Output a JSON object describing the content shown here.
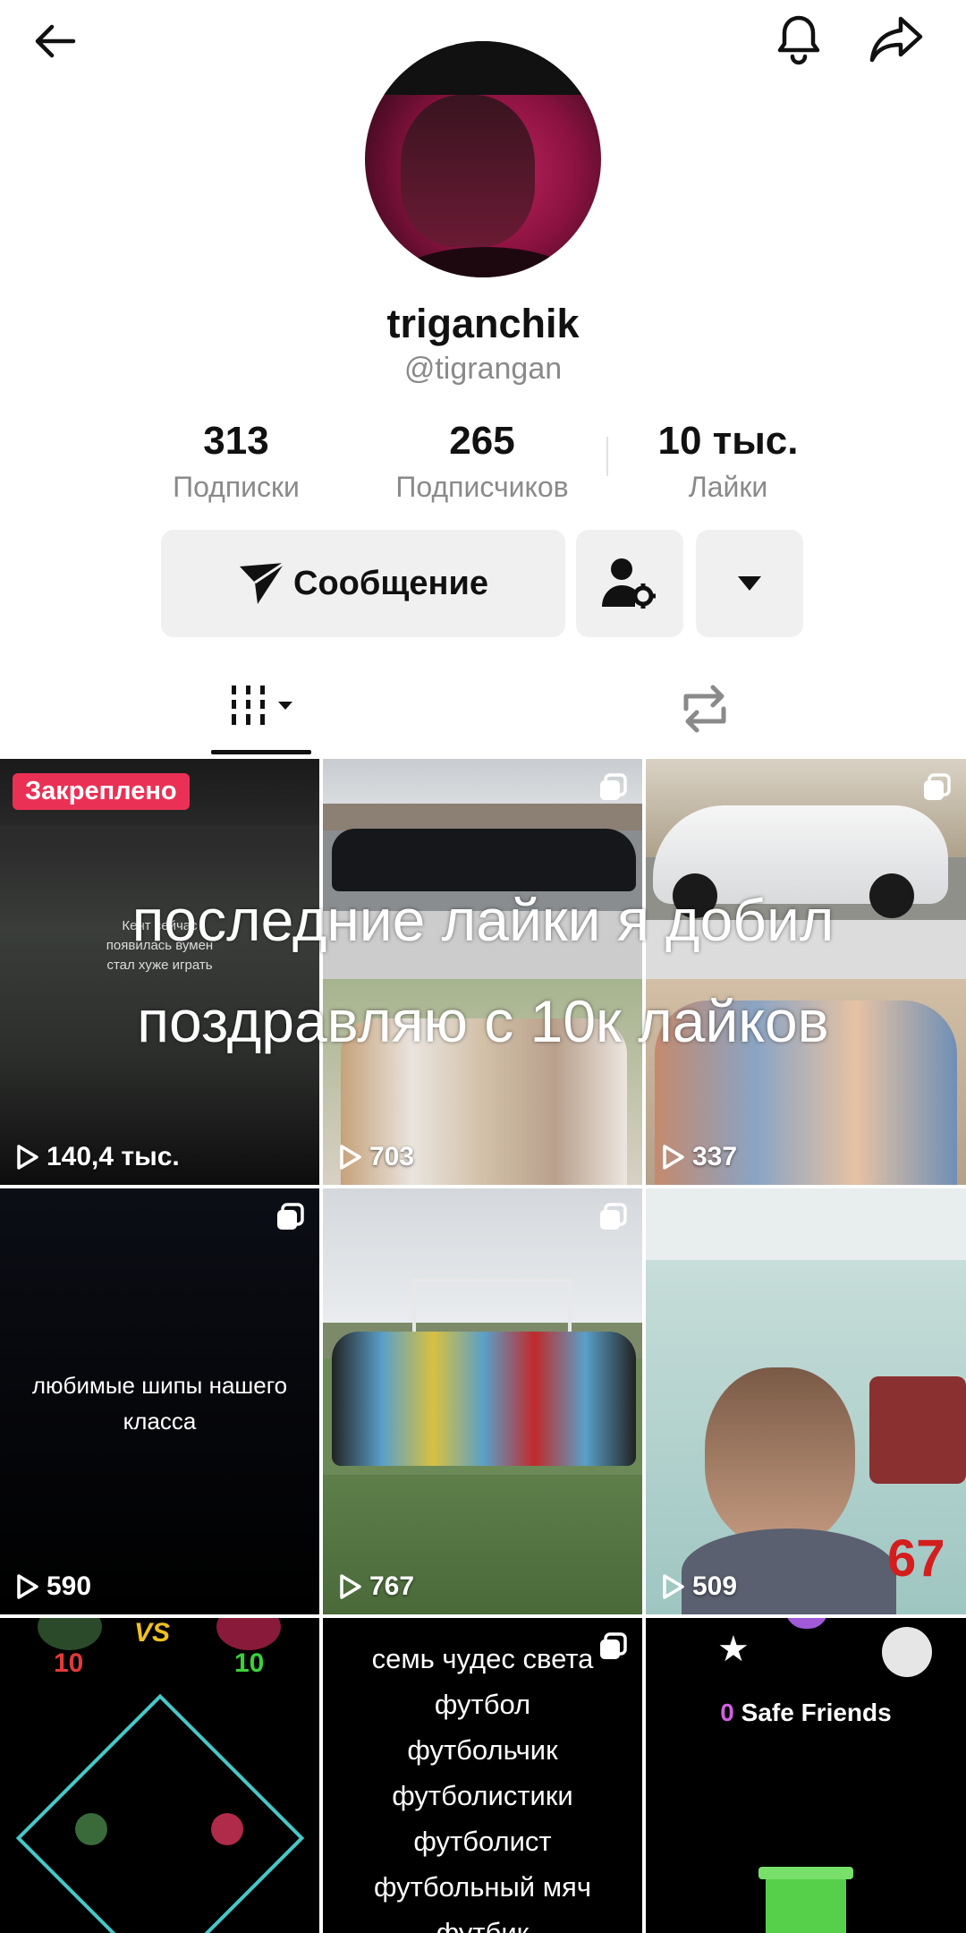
{
  "header": {
    "back_icon": "arrow-left-icon",
    "bell_icon": "bell-icon",
    "share_icon": "share-arrow-icon"
  },
  "profile": {
    "display_name": "triganchik",
    "handle": "@tigrangan",
    "stats": [
      {
        "value": "313",
        "label": "Подписки"
      },
      {
        "value": "265",
        "label": "Подписчиков"
      },
      {
        "value": "10 тыс.",
        "label": "Лайки"
      }
    ]
  },
  "actions": {
    "message_label": "Сообщение",
    "message_icon": "paper-plane-icon",
    "friend_icon": "person-gear-icon",
    "more_icon": "caret-down-icon"
  },
  "tabs": {
    "videos_icon": "grid-columns-icon",
    "reposts_icon": "repost-icon"
  },
  "overlay": {
    "line1": "последние лайки я добил",
    "line2": "поздравляю с 10к лайков"
  },
  "videos": [
    {
      "views": "140,4 тыс.",
      "pinned": "Закреплено",
      "caption": [
        "Кент сейчас",
        "появилась вумен",
        "стал хуже играть"
      ]
    },
    {
      "views": "703"
    },
    {
      "views": "337"
    },
    {
      "views": "590",
      "text": [
        "любимые шипы нашего",
        "класса"
      ]
    },
    {
      "views": "767"
    },
    {
      "views": "509",
      "sticker_number": "67"
    },
    {
      "score_left": "10",
      "score_right": "10",
      "vs_label": "VS"
    },
    {
      "text": [
        "семь чудес света",
        "футбол",
        "футбольчик",
        "футболистики",
        "футболист",
        "футбольный мяч",
        "футбик"
      ]
    },
    {
      "counter": "0",
      "label": "Safe Friends"
    }
  ]
}
